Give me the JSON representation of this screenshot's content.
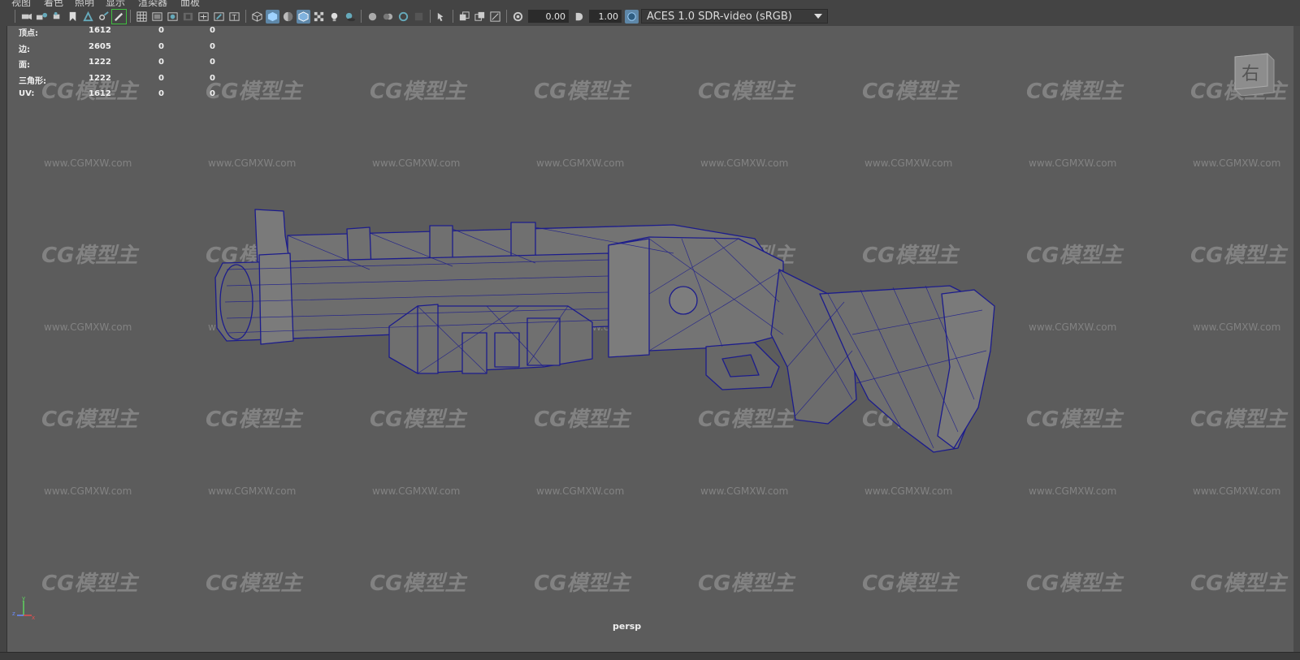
{
  "menu": [
    "视图",
    "着色",
    "照明",
    "显示",
    "渲染器",
    "面板"
  ],
  "toolbar": {
    "exposure_value": "0.00",
    "gamma_value": "1.00",
    "color_management": "ACES 1.0 SDR-video (sRGB)"
  },
  "hud": {
    "rows": [
      {
        "label": "顶点:",
        "v1": "1612",
        "v2": "0",
        "v3": "0"
      },
      {
        "label": "边:",
        "v1": "2605",
        "v2": "0",
        "v3": "0"
      },
      {
        "label": "面:",
        "v1": "1222",
        "v2": "0",
        "v3": "0"
      },
      {
        "label": "三角形:",
        "v1": "1222",
        "v2": "0",
        "v3": "0"
      },
      {
        "label": "UV:",
        "v1": "1612",
        "v2": "0",
        "v3": "0"
      }
    ]
  },
  "viewcube": {
    "face_label": "右"
  },
  "camera_label": "persp",
  "watermark": {
    "logo": "CG模型主",
    "url": "www.CGMXW.com"
  },
  "axis": {
    "x": "x",
    "y": "y",
    "z": "z"
  }
}
